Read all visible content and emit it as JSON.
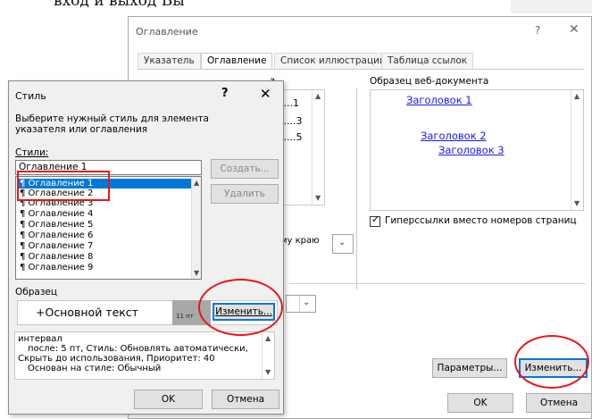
{
  "top_text": "вход и выход Вы",
  "back_dialog": {
    "title": "Оглавление",
    "help": "?",
    "close": "✕",
    "tabs": [
      "Указатель",
      "Оглавление",
      "Список иллюстраций",
      "Таблица ссылок"
    ],
    "print_label_fragment": "а",
    "print_rows": [
      "........1",
      ".........3",
      ".........5"
    ],
    "right_align_fragment": "му краю",
    "web_preview_label": "Образец веб-документа",
    "web_links": [
      "Заголовок 1",
      "Заголовок 2",
      "Заголовок 3"
    ],
    "hyperlinks_checkbox": "Гиперссылки вместо номеров страниц",
    "params_button": "Параметры...",
    "modify_button": "Изменить...",
    "ok_button": "OK",
    "cancel_button": "Отмена"
  },
  "style_dialog": {
    "title": "Стиль",
    "help": "?",
    "close": "✕",
    "instruction": "Выберите нужный стиль для элемента указателя или оглавления",
    "styles_label": "Стили:",
    "input_value": "Оглавление 1",
    "styles": [
      "Оглавление 1",
      "Оглавление 2",
      "Оглавление 3",
      "Оглавление 4",
      "Оглавление 5",
      "Оглавление 6",
      "Оглавление 7",
      "Оглавление 8",
      "Оглавление 9"
    ],
    "selected_index": 0,
    "create_button": "Создать...",
    "delete_button": "Удалить",
    "sample_label": "Образец",
    "sample_text": "+Основной текст",
    "sample_size": "11 пт",
    "modify_button": "Изменить...",
    "description": [
      "интервал",
      "после: 5 пт, Стиль: Обновлять автоматически,",
      "Скрыть до использования, Приоритет: 40",
      "Основан на стиле: Обычный"
    ],
    "ok_button": "OK",
    "cancel_button": "Отмена"
  },
  "colors": {
    "accent": "#0078d7",
    "highlight": "#e8161a",
    "link": "#1a1aee"
  }
}
